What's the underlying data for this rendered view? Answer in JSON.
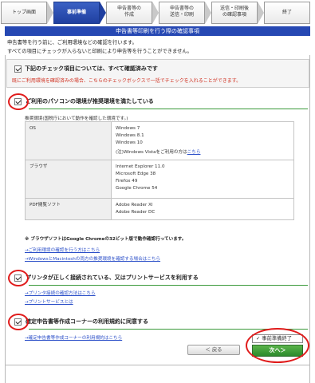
{
  "steps": [
    {
      "label": "トップ画面"
    },
    {
      "label": "事前準備"
    },
    {
      "label": "申告書等の\n作成"
    },
    {
      "label": "申告書等の\n送信・印刷"
    },
    {
      "label": "送信・印刷後\nの確認事項"
    },
    {
      "label": "終了"
    }
  ],
  "title": "申告書等印刷を行う際の確認事項",
  "intro": {
    "line1": "申告書等を行う前に、ご利用環境などの確認を行います。",
    "line2": "すべての項目にチェックが入らないと印刷により申告等を行うことができません。"
  },
  "all_check": {
    "checked": true,
    "label": "下記のチェック項目については、すべて確認済みです",
    "note": "既にご利用環境を確認済みの場合、こちらのチェックボックスで一括でチェックを入れることができます。"
  },
  "pc_section": {
    "checked": true,
    "label": "ご利用のパソコンの環境が推奨環境を満たしている",
    "caption": "推奨環境(国税庁において動作を確認した環境です。)",
    "rows": [
      {
        "key": "OS",
        "lines": [
          "Windows 7",
          "Windows 8.1",
          "Windows 10"
        ],
        "extra": "(注)Windows Vistaをご利用の方は",
        "extra_link": "こちら"
      },
      {
        "key": "ブラウザ",
        "lines": [
          "Internet Explorer 11.0",
          "Microsoft Edge 38",
          "Firefox 49",
          "Google Chrome 54"
        ]
      },
      {
        "key": "PDF閲覧ソフト",
        "lines": [
          "Adobe Reader XI",
          "Adobe Reader DC"
        ]
      }
    ],
    "note": "※ ブラウザソフトはGoogle Chromeの32ビット版で動作確認行っています。",
    "link1": "→ご利用環境の確認を行う方はこちら",
    "link2": "→WindowsとMacintoshの両方の推奨環境を確認する場合はこちら"
  },
  "printer_section": {
    "checked": true,
    "label": "プリンタが正しく接続されている、又はプリントサービスを利用する",
    "link1": "→プリンタ接続の確認方法はこちら",
    "link2": "→プリントサービスとは"
  },
  "terms_section": {
    "checked": true,
    "label": "確定申告書等作成コーナーの利用規約に同意する",
    "link": "→確定申告書等作成コーナーの利用規約はこちら"
  },
  "buttons": {
    "back": "＜ 戻る",
    "done_check": "✓",
    "done": "事前準備終了",
    "next": "次へ＞"
  },
  "colors": {
    "title": "#2648b3",
    "accent_green": "#3a9a3a",
    "highlight": "#e01b1b"
  }
}
